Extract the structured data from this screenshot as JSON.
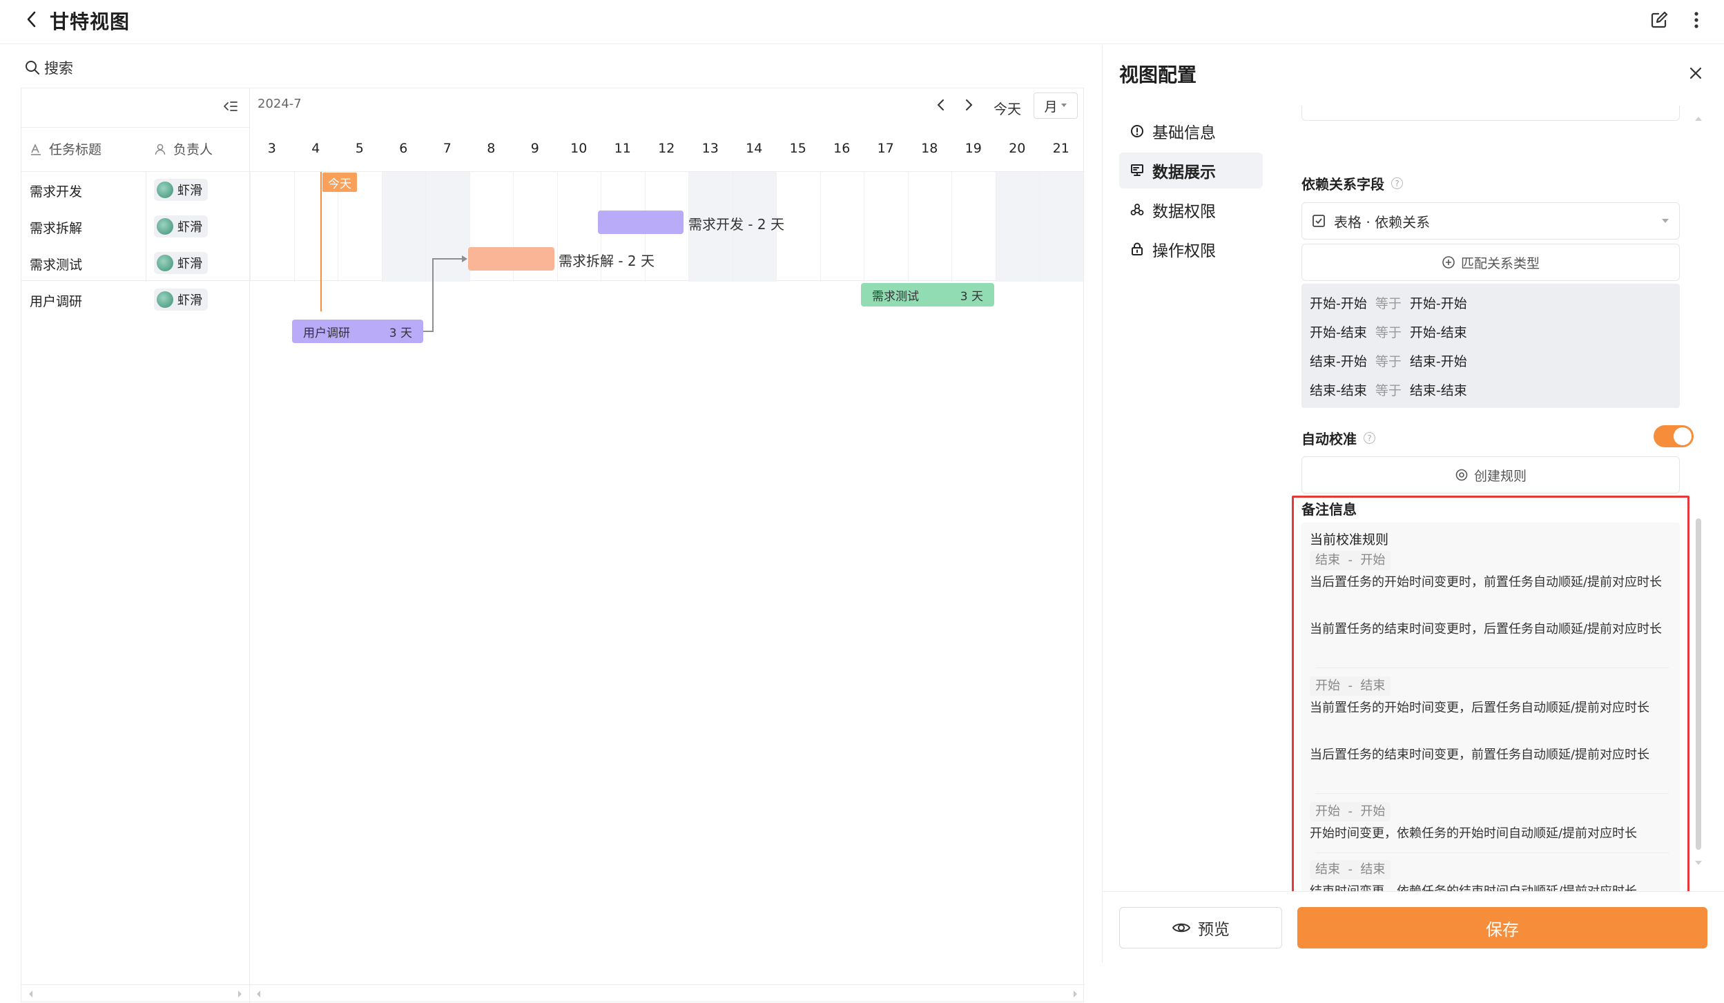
{
  "header": {
    "title": "甘特视图"
  },
  "search": {
    "label": "搜索"
  },
  "gantt": {
    "month_label": "2024-7",
    "today_button": "今天",
    "scale_select": "月",
    "today_marker": "今天",
    "columns": {
      "title": "任务标题",
      "assignee": "负责人"
    },
    "days": [
      "3",
      "4",
      "5",
      "6",
      "7",
      "8",
      "9",
      "10",
      "11",
      "12",
      "13",
      "14",
      "15",
      "16",
      "17",
      "18",
      "19",
      "20",
      "21"
    ],
    "tasks": [
      {
        "title": "需求开发",
        "assignee": "虾滑"
      },
      {
        "title": "需求拆解",
        "assignee": "虾滑"
      },
      {
        "title": "需求测试",
        "assignee": "虾滑"
      },
      {
        "title": "用户调研",
        "assignee": "虾滑"
      }
    ],
    "bars": {
      "dev_label": "需求开发 - 2 天",
      "split_label": "需求拆解 - 2 天",
      "test_name": "需求测试",
      "test_days": "3 天",
      "research_name": "用户调研",
      "research_days": "3 天"
    }
  },
  "config": {
    "title": "视图配置",
    "nav": [
      {
        "label": "基础信息",
        "icon": "info-icon"
      },
      {
        "label": "数据展示",
        "icon": "display-icon"
      },
      {
        "label": "数据权限",
        "icon": "data-permission-icon"
      },
      {
        "label": "操作权限",
        "icon": "lock-icon"
      }
    ],
    "dependency_field": {
      "title": "依赖关系字段",
      "select_value": "表格 · 依赖关系",
      "match_button": "匹配关系类型",
      "relations": [
        {
          "left": "开始-开始",
          "op": "等于",
          "right": "开始-开始"
        },
        {
          "left": "开始-结束",
          "op": "等于",
          "right": "开始-结束"
        },
        {
          "left": "结束-开始",
          "op": "等于",
          "right": "结束-开始"
        },
        {
          "left": "结束-结束",
          "op": "等于",
          "right": "结束-结束"
        }
      ]
    },
    "auto_calibrate": {
      "title": "自动校准",
      "enabled": true,
      "create_rule": "创建规则"
    },
    "notes": {
      "title": "备注信息",
      "current_rule": "当前校准规则",
      "rules": [
        {
          "from": "结束",
          "to": "开始",
          "lines": [
            "当后置任务的开始时间变更时，前置任务自动顺延/提前对应时长",
            "当前置任务的结束时间变更时，后置任务自动顺延/提前对应时长"
          ]
        },
        {
          "from": "开始",
          "to": "结束",
          "lines": [
            "当前置任务的开始时间变更，后置任务自动顺延/提前对应时长",
            "当后置任务的结束时间变更，前置任务自动顺延/提前对应时长"
          ]
        },
        {
          "from": "开始",
          "to": "开始",
          "lines": [
            "开始时间变更，依赖任务的开始时间自动顺延/提前对应时长"
          ]
        },
        {
          "from": "结束",
          "to": "结束",
          "lines": [
            "结束时间变更，依赖任务的结束时间自动顺延/提前对应时长"
          ]
        }
      ],
      "separator": "-"
    },
    "footer": {
      "preview": "预览",
      "save": "保存"
    },
    "colors": {
      "accent": "#f58d3b",
      "highlight_border": "#e5393b",
      "purple_bar": "#b9abf7",
      "orange_bar": "#f9b596",
      "green_bar": "#92dcb4"
    }
  }
}
